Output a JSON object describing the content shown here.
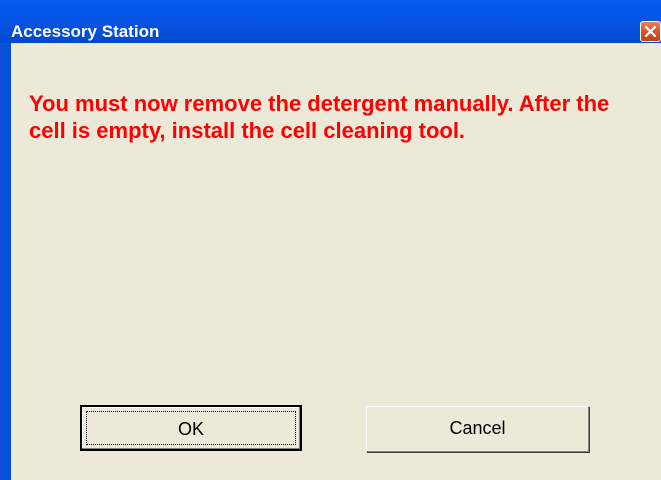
{
  "window": {
    "title": "Accessory Station",
    "close_icon": "close-icon"
  },
  "dialog": {
    "message": "You must now remove the detergent manually.  After the cell is empty, install the cell cleaning tool.",
    "message_color": "#ff0000"
  },
  "buttons": {
    "ok_label": "OK",
    "cancel_label": "Cancel"
  },
  "colors": {
    "titlebar": "#0a55e5",
    "client_background": "#ece9d8",
    "close_button": "#d9532c"
  }
}
